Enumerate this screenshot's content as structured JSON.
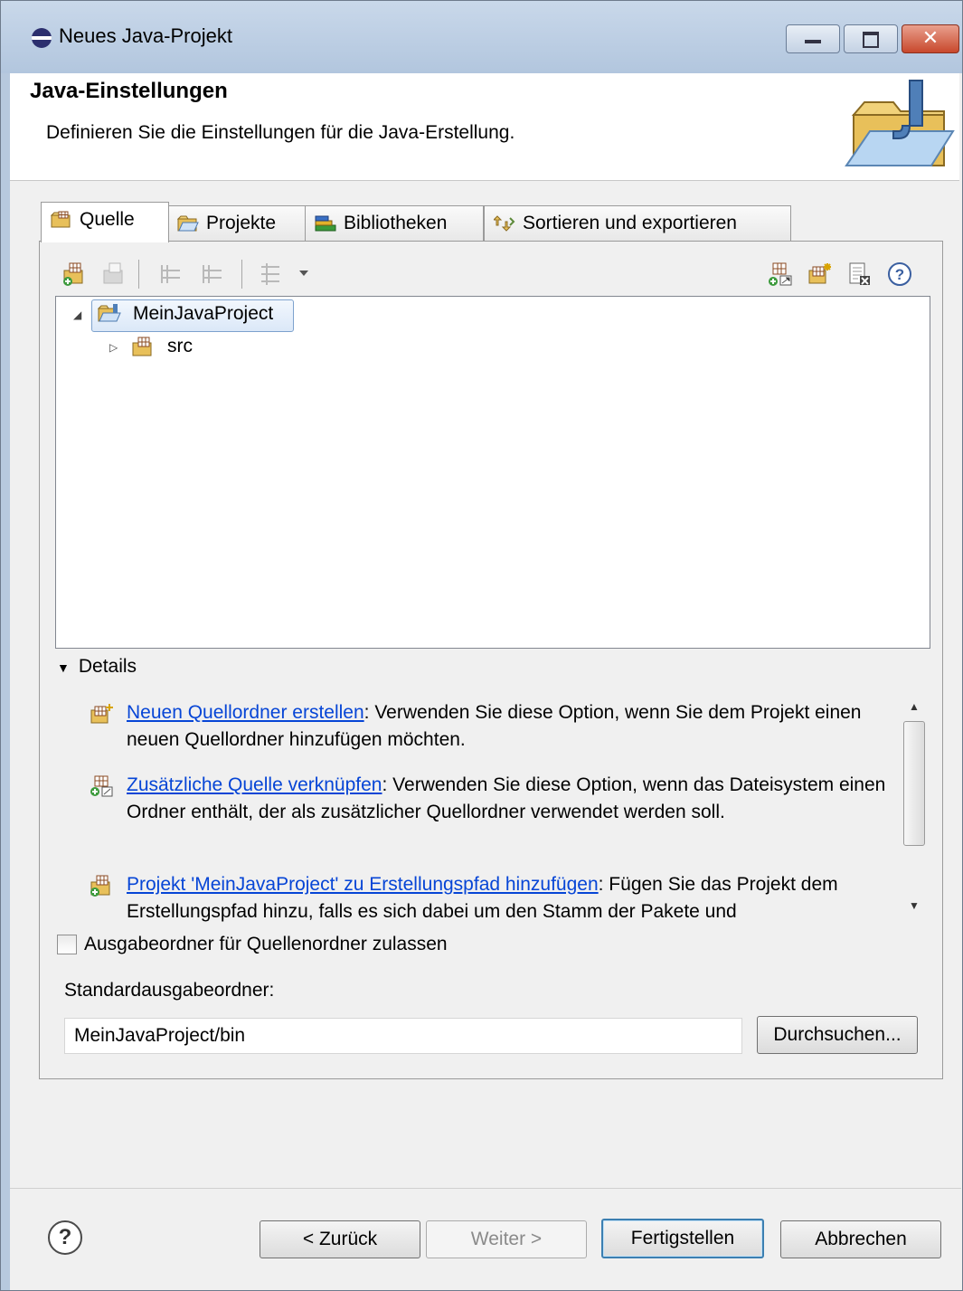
{
  "window": {
    "title": "Neues Java-Projekt"
  },
  "header": {
    "title": "Java-Einstellungen",
    "description": "Definieren Sie die Einstellungen für die Java-Erstellung."
  },
  "tabs": [
    {
      "label": "Quelle",
      "icon": "source-folder-icon"
    },
    {
      "label": "Projekte",
      "icon": "project-folder-icon"
    },
    {
      "label": "Bibliotheken",
      "icon": "libraries-icon"
    },
    {
      "label": "Sortieren und exportieren",
      "icon": "order-export-icon"
    }
  ],
  "tree": {
    "items": [
      {
        "label": "MeinJavaProject",
        "expanded": true,
        "selected": true
      },
      {
        "label": "src",
        "expanded": false
      }
    ]
  },
  "details": {
    "label": "Details",
    "items": [
      {
        "link": "Neuen Quellordner erstellen",
        "text": ": Verwenden Sie diese Option, wenn Sie dem Projekt einen neuen Quellordner hinzufügen möchten."
      },
      {
        "link": "Zusätzliche Quelle verknüpfen",
        "text": ": Verwenden Sie diese Option, wenn das Dateisystem einen Ordner enthält, der als zusätzlicher Quellordner verwendet werden soll."
      },
      {
        "link": "Projekt 'MeinJavaProject' zu Erstellungspfad hinzufügen",
        "text": ": Fügen Sie das Projekt dem Erstellungspfad hinzu, falls es sich dabei um den Stamm der Pakete und"
      }
    ]
  },
  "options": {
    "allow_output_folders_label": "Ausgabeordner für Quellenordner zulassen",
    "allow_output_folders_checked": false,
    "default_output_label": "Standardausgabeordner:",
    "default_output_value": "MeinJavaProject/bin",
    "browse_label": "Durchsuchen..."
  },
  "buttons": {
    "back": "< Zurück",
    "next": "Weiter >",
    "finish": "Fertigstellen",
    "cancel": "Abbrechen",
    "help": "?"
  }
}
